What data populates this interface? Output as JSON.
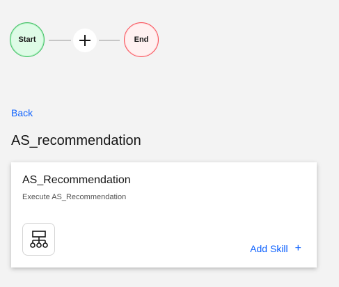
{
  "flow": {
    "start_label": "Start",
    "end_label": "End",
    "add_step_icon": "plus-icon"
  },
  "nav": {
    "back_label": "Back"
  },
  "page": {
    "title": "AS_recommendation"
  },
  "card": {
    "title": "AS_Recommendation",
    "description": "Execute AS_Recommendation",
    "tile_icon": "flow-tree-icon",
    "add_skill_label": "Add Skill",
    "add_skill_icon": "plus-icon"
  },
  "colors": {
    "link": "#0f62fe",
    "start_fill": "#defbe6",
    "start_border": "#42be65",
    "end_fill": "#fff1f1",
    "end_border": "#fa4d56",
    "background": "#f3f3f3"
  }
}
